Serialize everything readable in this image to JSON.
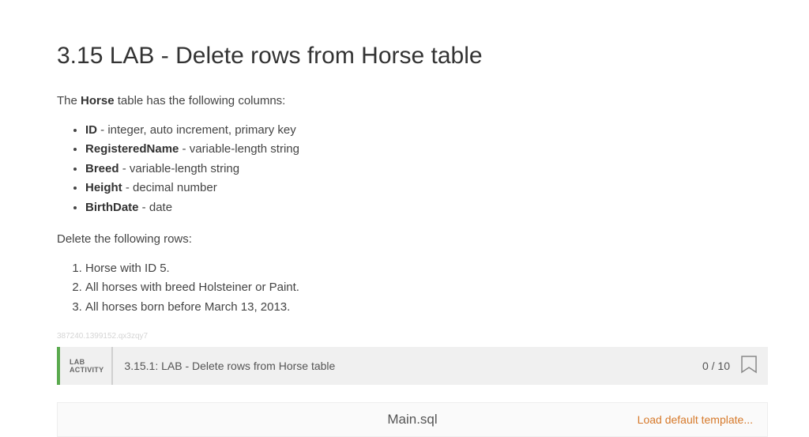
{
  "title": "3.15 LAB - Delete rows from Horse table",
  "intro_pre": "The ",
  "intro_bold": "Horse",
  "intro_post": " table has the following columns:",
  "columns": [
    {
      "name": "ID",
      "desc": " - integer, auto increment, primary key"
    },
    {
      "name": "RegisteredName",
      "desc": " - variable-length string"
    },
    {
      "name": "Breed",
      "desc": " - variable-length string"
    },
    {
      "name": "Height",
      "desc": " - decimal number"
    },
    {
      "name": "BirthDate",
      "desc": " - date"
    }
  ],
  "task_intro": "Delete the following rows:",
  "tasks": [
    "Horse with ID 5.",
    "All horses with breed Holsteiner or Paint.",
    "All horses born before March 13, 2013."
  ],
  "watermark": "387240.1399152.qx3zqy7",
  "lab": {
    "label_line1": "LAB",
    "label_line2": "ACTIVITY",
    "title": "3.15.1: LAB - Delete rows from Horse table",
    "score": "0 / 10"
  },
  "file": {
    "name": "Main.sql",
    "load_label": "Load default template..."
  }
}
